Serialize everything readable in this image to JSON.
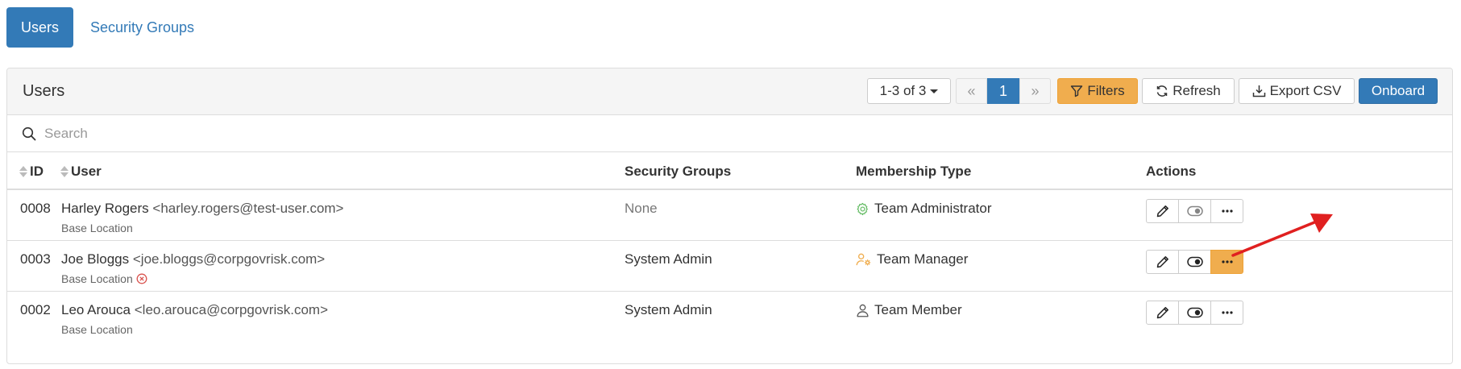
{
  "tabs": [
    {
      "label": "Users",
      "active": true
    },
    {
      "label": "Security Groups",
      "active": false
    }
  ],
  "panel": {
    "title": "Users",
    "toolbar": {
      "range_label": "1-3 of 3",
      "pager": {
        "first": "«",
        "current": "1",
        "last": "»"
      },
      "filters_label": "Filters",
      "refresh_label": "Refresh",
      "export_label": "Export CSV",
      "onboard_label": "Onboard"
    },
    "search": {
      "placeholder": "Search",
      "value": ""
    }
  },
  "table": {
    "headers": {
      "id": "ID",
      "user": "User",
      "security_groups": "Security Groups",
      "membership_type": "Membership Type",
      "actions": "Actions"
    },
    "rows": [
      {
        "id": "0008",
        "name": "Harley Rogers",
        "email": "<harley.rogers@test-user.com>",
        "location": "Base Location",
        "location_error": false,
        "security_groups": "None",
        "membership_type": "Team Administrator",
        "membership_icon": "gear-icon",
        "toggle_dim": true,
        "more_highlighted": false
      },
      {
        "id": "0003",
        "name": "Joe Bloggs",
        "email": "<joe.bloggs@corpgovrisk.com>",
        "location": "Base Location",
        "location_error": true,
        "security_groups": "System Admin",
        "membership_type": "Team Manager",
        "membership_icon": "user-cog-icon",
        "toggle_dim": false,
        "more_highlighted": true
      },
      {
        "id": "0002",
        "name": "Leo Arouca",
        "email": "<leo.arouca@corpgovrisk.com>",
        "location": "Base Location",
        "location_error": false,
        "security_groups": "System Admin",
        "membership_type": "Team Member",
        "membership_icon": "user-icon",
        "toggle_dim": false,
        "more_highlighted": false
      }
    ]
  },
  "colors": {
    "primary": "#337ab7",
    "warning": "#f0ad4e",
    "admin_icon": "#5cb85c",
    "manager_icon": "#f0ad4e",
    "error": "#d9534f",
    "annotation_arrow": "#e02020"
  }
}
